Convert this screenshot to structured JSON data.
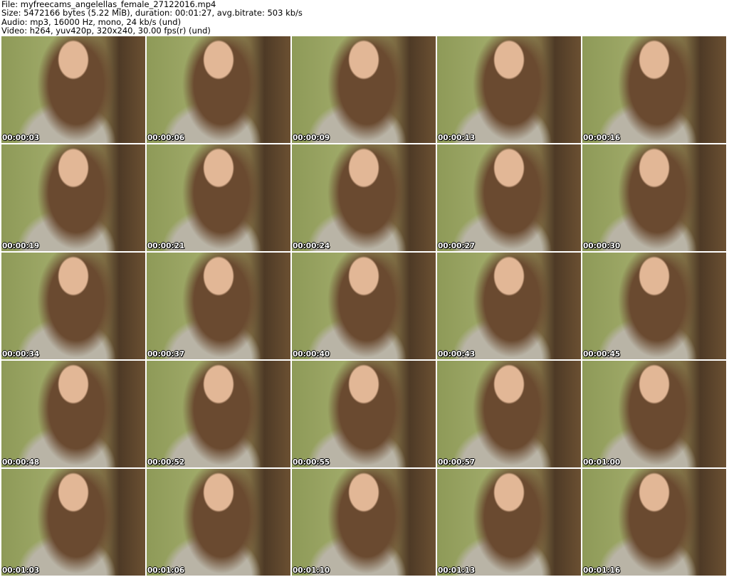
{
  "header": {
    "file": "File: myfreecams_angelellas_female_27122016.mp4",
    "size": "Size: 5472166 bytes (5.22 MiB), duration: 00:01:27, avg.bitrate: 503 kb/s",
    "audio": "Audio: mp3, 16000 Hz, mono, 24 kb/s (und)",
    "video": "Video: h264, yuv420p, 320x240, 30.00 fps(r) (und)"
  },
  "timestamps": [
    "00:00:03",
    "00:00:06",
    "00:00:09",
    "00:00:13",
    "00:00:16",
    "00:00:19",
    "00:00:21",
    "00:00:24",
    "00:00:27",
    "00:00:30",
    "00:00:34",
    "00:00:37",
    "00:00:40",
    "00:00:43",
    "00:00:45",
    "00:00:48",
    "00:00:52",
    "00:00:55",
    "00:00:57",
    "00:01:00",
    "00:01:03",
    "00:01:06",
    "00:01:10",
    "00:01:13",
    "00:01:16"
  ]
}
